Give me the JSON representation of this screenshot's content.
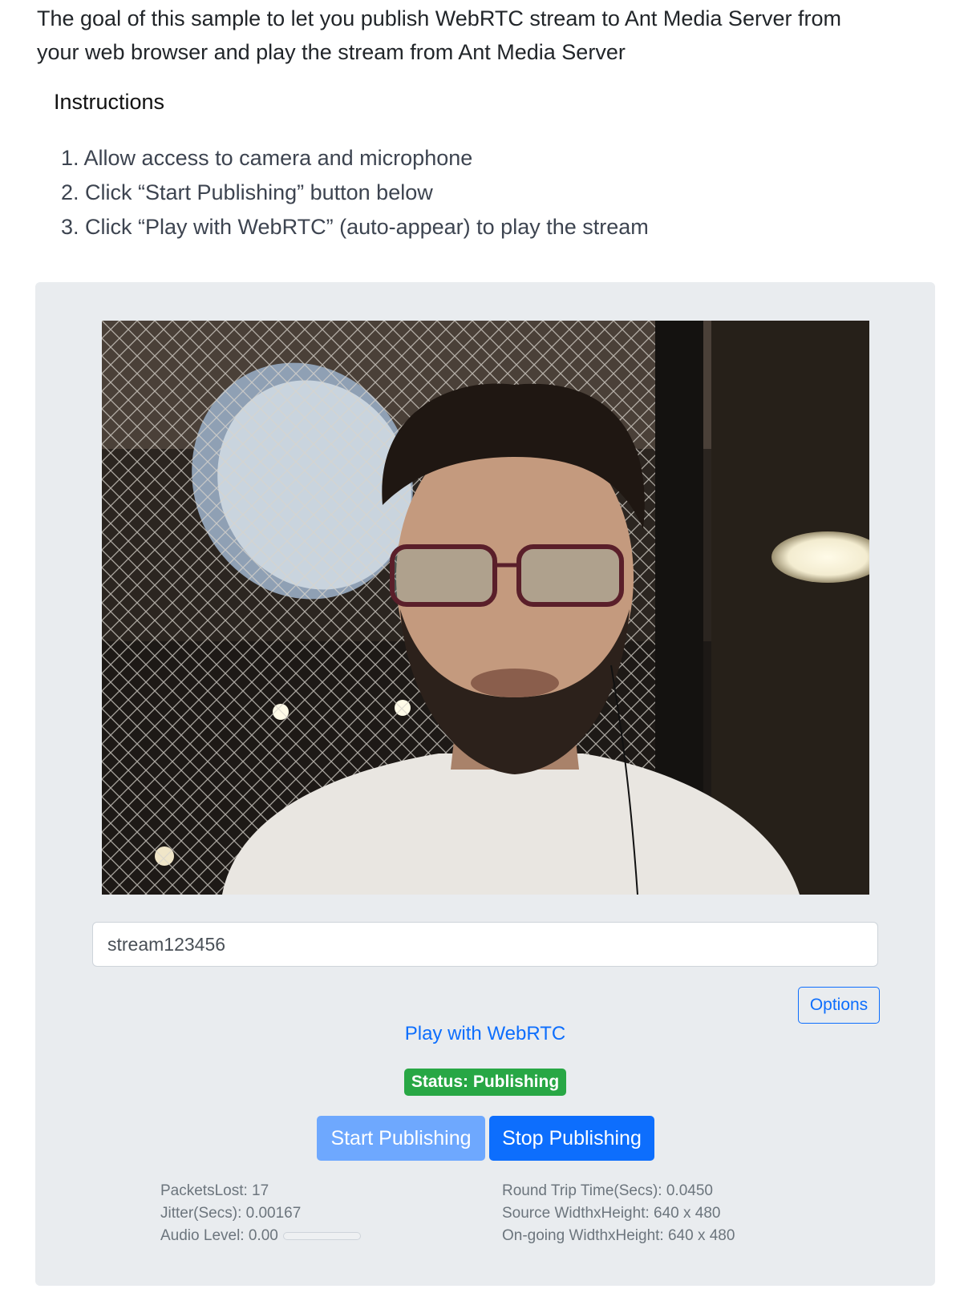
{
  "intro": {
    "line1": "The goal of this sample to let you publish WebRTC stream to Ant Media Server from",
    "line2": "your web browser and play the stream from Ant Media Server"
  },
  "instructions": {
    "title": "Instructions",
    "steps": [
      "1. Allow access to camera and microphone",
      "2. Click “Start Publishing” button below",
      "3. Click “Play with WebRTC” (auto-appear) to play the stream"
    ]
  },
  "publisher": {
    "stream_id": "stream123456",
    "options_label": "Options",
    "play_link_label": "Play with WebRTC",
    "status_label": "Status: Publishing",
    "start_label": "Start Publishing",
    "stop_label": "Stop Publishing"
  },
  "stats": {
    "packets_lost": "PacketsLost: 17",
    "jitter": "Jitter(Secs): 0.00167",
    "audio_level": "Audio Level: 0.00",
    "rtt": "Round Trip Time(Secs): 0.0450",
    "source_dims": "Source WidthxHeight: 640 x 480",
    "ongoing_dims": "On-going WidthxHeight: 640 x 480"
  },
  "colors": {
    "primary": "#0d6efd",
    "primary_disabled": "#6ea8fe",
    "status_green": "#28a745",
    "panel_bg": "#e9ecef"
  }
}
